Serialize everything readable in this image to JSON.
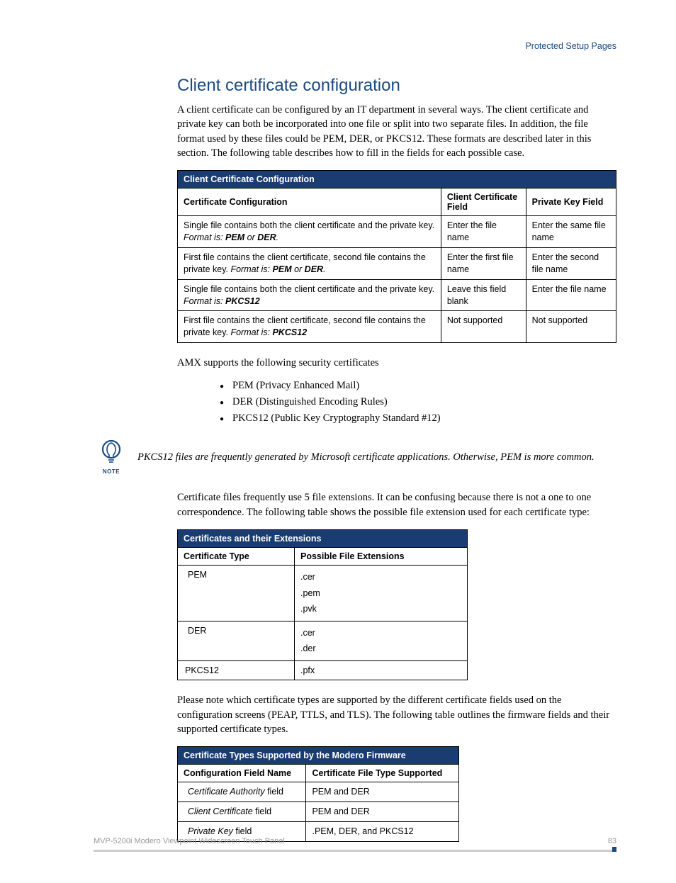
{
  "header_right": "Protected Setup Pages",
  "title": "Client certificate configuration",
  "intro": "A client certificate can be configured by an IT department in several ways. The client certificate and private key can both be incorporated into one file or split into two separate files. In addition, the file format used by these files could be PEM, DER, or PKCS12. These formats are described later in this section. The following table describes how to fill in the fields for each possible case.",
  "table1": {
    "title": "Client Certificate Configuration",
    "headers": [
      "Certificate Configuration",
      "Client Certificate Field",
      "Private Key Field"
    ],
    "rows": [
      {
        "c1a": "Single file contains both the client certificate and the private key. ",
        "c1b": "Format is: ",
        "c1c": "PEM",
        "c1d": " or ",
        "c1e": "DER",
        "c1f": ".",
        "c2": "Enter the file name",
        "c3": "Enter the same file name"
      },
      {
        "c1a": "First file contains the client certificate, second file contains the private key. ",
        "c1b": "Format is: ",
        "c1c": "PEM",
        "c1d": " or ",
        "c1e": "DER",
        "c1f": ".",
        "c2": "Enter the first file name",
        "c3": "Enter the second file name"
      },
      {
        "c1a": "Single file contains both the client certificate and the private key. ",
        "c1b": "Format is: ",
        "c1c": "PKCS12",
        "c1d": "",
        "c1e": "",
        "c1f": "",
        "c2": "Leave this field blank",
        "c3": "Enter the file name"
      },
      {
        "c1a": "First file contains the client certificate, second file contains the private key. ",
        "c1b": "Format is: ",
        "c1c": "PKCS12",
        "c1d": "",
        "c1e": "",
        "c1f": "",
        "c2": "Not supported",
        "c3": "Not supported"
      }
    ]
  },
  "para2": "AMX supports the following security certificates",
  "bullets": [
    "PEM (Privacy Enhanced Mail)",
    "DER (Distinguished Encoding Rules)",
    "PKCS12 (Public Key Cryptography Standard #12)"
  ],
  "note_label": "NOTE",
  "note_text": "PKCS12 files are frequently generated by Microsoft certificate applications. Otherwise, PEM is more common.",
  "para3": "Certificate files frequently use 5 file extensions. It can be confusing because there is not a one to one correspondence. The following table shows the possible file extension used for each certificate type:",
  "table2": {
    "title": "Certificates and their Extensions",
    "headers": [
      "Certificate Type",
      "Possible File Extensions"
    ],
    "rows": [
      {
        "type": "PEM",
        "exts": [
          ".cer",
          ".pem",
          ".pvk"
        ]
      },
      {
        "type": "DER",
        "exts": [
          ".cer",
          ".der"
        ]
      },
      {
        "type": "PKCS12",
        "exts": [
          ".pfx"
        ]
      }
    ]
  },
  "para4": "Please note which certificate types are supported by the different certificate fields used on the configuration screens (PEAP, TTLS, and TLS). The following table outlines the firmware fields and their supported certificate types.",
  "table3": {
    "title": "Certificate Types Supported by the Modero Firmware",
    "headers": [
      "Configuration Field Name",
      "Certificate File Type Supported"
    ],
    "rows": [
      {
        "name_i": "Certificate Authority",
        "name": " field",
        "sup": "PEM and DER"
      },
      {
        "name_i": "Client Certificate",
        "name": " field",
        "sup": "PEM and DER"
      },
      {
        "name_i": "Private Key",
        "name": " field",
        "sup": ".PEM, DER, and PKCS12"
      }
    ]
  },
  "footer_left": "MVP-5200i Modero Viewpoint Widescreen Touch Panel",
  "footer_right": "83"
}
